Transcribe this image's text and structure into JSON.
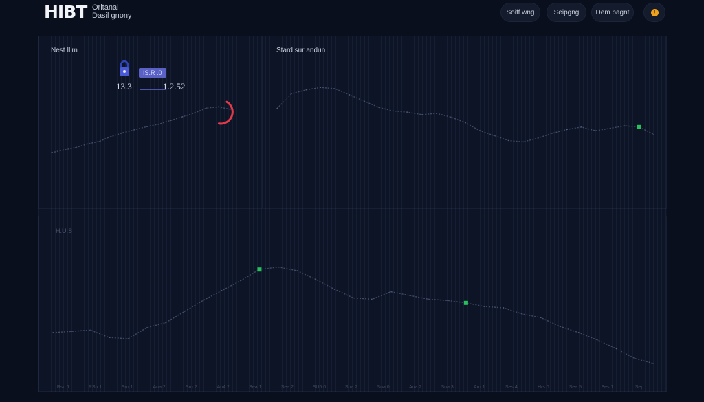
{
  "header": {
    "logo": "HIBT",
    "subtitle_line1": "Oritanal",
    "subtitle_line2": "Dasil gnony",
    "buttons": [
      {
        "label": "Soiff wng"
      },
      {
        "label": "Seipgng"
      },
      {
        "label": "Dem pagnt"
      }
    ],
    "alert_icon": "warning-icon",
    "alert_symbol": "!"
  },
  "panels": {
    "panel1": {
      "title": "Nest Ilim",
      "lock_icon": "lock-icon",
      "badge": "IS.R .0",
      "stat_a": "13.3",
      "stat_b": "1.2.52"
    },
    "panel2": {
      "title": "Stard sur andun"
    },
    "panel3": {
      "title": "H.U.S"
    }
  },
  "colors": {
    "accent_blue": "#4a5ad6",
    "gauge_red": "#e23a48",
    "marker_green": "#27c05a",
    "badge_bg": "#5a61c4"
  },
  "chart_data": [
    {
      "type": "line",
      "panel": "panel1",
      "x": [
        0,
        1,
        2,
        3,
        4,
        5,
        6,
        7,
        8,
        9,
        10,
        11,
        12,
        13,
        14,
        15
      ],
      "values": [
        40,
        44,
        48,
        54,
        58,
        66,
        72,
        77,
        82,
        86,
        92,
        98,
        104,
        112,
        114,
        110
      ],
      "gauge": {
        "color": "#e23a48"
      }
    },
    {
      "type": "line",
      "panel": "panel2",
      "x": [
        0,
        1,
        2,
        3,
        4,
        5,
        6,
        7,
        8,
        9,
        10,
        11,
        12,
        13,
        14,
        15,
        16,
        17,
        18,
        19,
        20,
        21,
        22,
        23,
        24,
        25,
        26
      ],
      "values": [
        78,
        102,
        108,
        112,
        110,
        100,
        90,
        80,
        74,
        72,
        68,
        70,
        64,
        55,
        42,
        34,
        26,
        24,
        30,
        38,
        44,
        48,
        42,
        46,
        50,
        48,
        36
      ],
      "highlight_index": 25
    },
    {
      "type": "line",
      "panel": "panel3",
      "x": [
        0,
        1,
        2,
        3,
        4,
        5,
        6,
        7,
        8,
        9,
        10,
        11,
        12,
        13,
        14,
        15,
        16,
        17,
        18,
        19,
        20,
        21,
        22,
        23,
        24,
        25,
        26,
        27,
        28,
        29,
        30,
        31,
        32
      ],
      "values": [
        70,
        72,
        74,
        62,
        60,
        78,
        86,
        104,
        122,
        138,
        154,
        172,
        176,
        170,
        156,
        140,
        126,
        124,
        136,
        130,
        124,
        122,
        118,
        112,
        110,
        100,
        94,
        80,
        70,
        58,
        44,
        28,
        20
      ],
      "highlight_indices": [
        11,
        22
      ]
    }
  ],
  "x_ticks": [
    "Rsu 1",
    "RSu 1",
    "Sru 1",
    "Aua 2",
    "Sru 2",
    "Au4 2",
    "Sea 1",
    "Sea 2",
    "SU5 0",
    "Sua 2",
    "Sua 0",
    "Aua 2",
    "Sua 3",
    "Aru 1",
    "Ses 4",
    "Hrs 0",
    "Sea 5",
    "Ses 1",
    "Sep"
  ]
}
